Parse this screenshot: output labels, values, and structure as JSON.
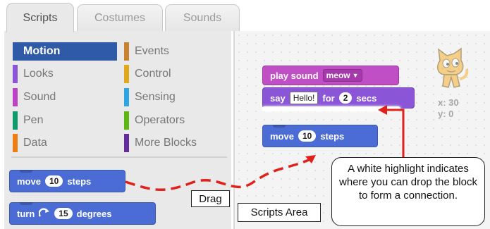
{
  "tabs": [
    {
      "label": "Scripts"
    },
    {
      "label": "Costumes"
    },
    {
      "label": "Sounds"
    }
  ],
  "categories": [
    {
      "label": "Motion",
      "color": "#2e5aa8"
    },
    {
      "label": "Looks",
      "color": "#8a55d7"
    },
    {
      "label": "Sound",
      "color": "#bb42c3"
    },
    {
      "label": "Pen",
      "color": "#0e9a6c"
    },
    {
      "label": "Data",
      "color": "#ee7d16"
    },
    {
      "label": "Events",
      "color": "#c88330"
    },
    {
      "label": "Control",
      "color": "#e1a91a"
    },
    {
      "label": "Sensing",
      "color": "#2ca5e2"
    },
    {
      "label": "Operators",
      "color": "#5cb712"
    },
    {
      "label": "More Blocks",
      "color": "#632d99"
    }
  ],
  "palette_blocks": {
    "move": {
      "prefix": "move",
      "value": "10",
      "suffix": "steps"
    },
    "turn": {
      "prefix": "turn",
      "icon": "rotate-clockwise-icon",
      "value": "15",
      "suffix": "degrees"
    }
  },
  "script_blocks": {
    "play_sound": {
      "prefix": "play sound",
      "option": "meow"
    },
    "say": {
      "prefix": "say",
      "text": "Hello!",
      "middle": "for",
      "value": "2",
      "suffix": "secs"
    },
    "move": {
      "prefix": "move",
      "value": "10",
      "suffix": "steps"
    }
  },
  "sprite": {
    "icon": "cat-sprite-icon",
    "x_label": "x: 30",
    "y_label": "y: 0"
  },
  "annotations": {
    "drag": "Drag",
    "scripts_area": "Scripts Area",
    "callout": "A white highlight indicates where you can drop the block to form a connection.",
    "arrow_color": "#e0201b"
  }
}
